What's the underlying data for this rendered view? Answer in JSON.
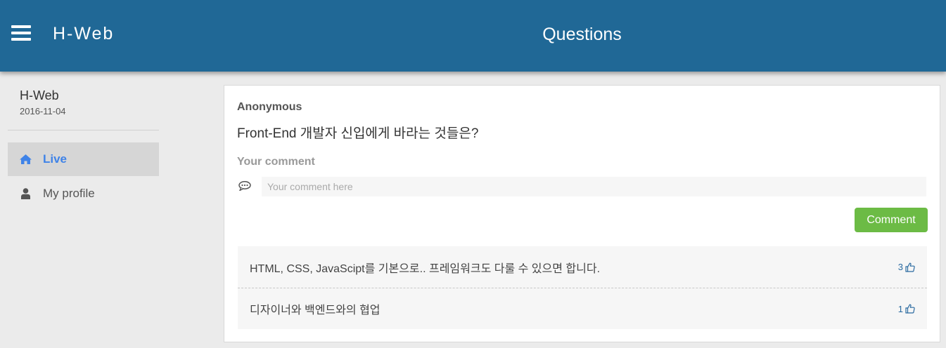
{
  "header": {
    "brand": "H-Web",
    "title": "Questions",
    "bar_color": "#206896"
  },
  "sidebar": {
    "user_name": "H-Web",
    "user_date": "2016-11-04",
    "items": [
      {
        "label": "Live",
        "icon": "home-icon",
        "active": true
      },
      {
        "label": "My profile",
        "icon": "user-icon",
        "active": false
      }
    ]
  },
  "question": {
    "author": "Anonymous",
    "text": "Front-End 개발자 신입에게 바라는 것들은?"
  },
  "comment_form": {
    "heading": "Your comment",
    "placeholder": "Your comment here",
    "value": "",
    "button_label": "Comment",
    "button_color": "#6cbb45"
  },
  "answers": [
    {
      "text": "HTML, CSS, JavaScipt를 기본으로.. 프레임워크도 다룰 수 있으면 합니다.",
      "likes": "3"
    },
    {
      "text": "디자이너와 백엔드와의 협업",
      "likes": "1"
    }
  ]
}
